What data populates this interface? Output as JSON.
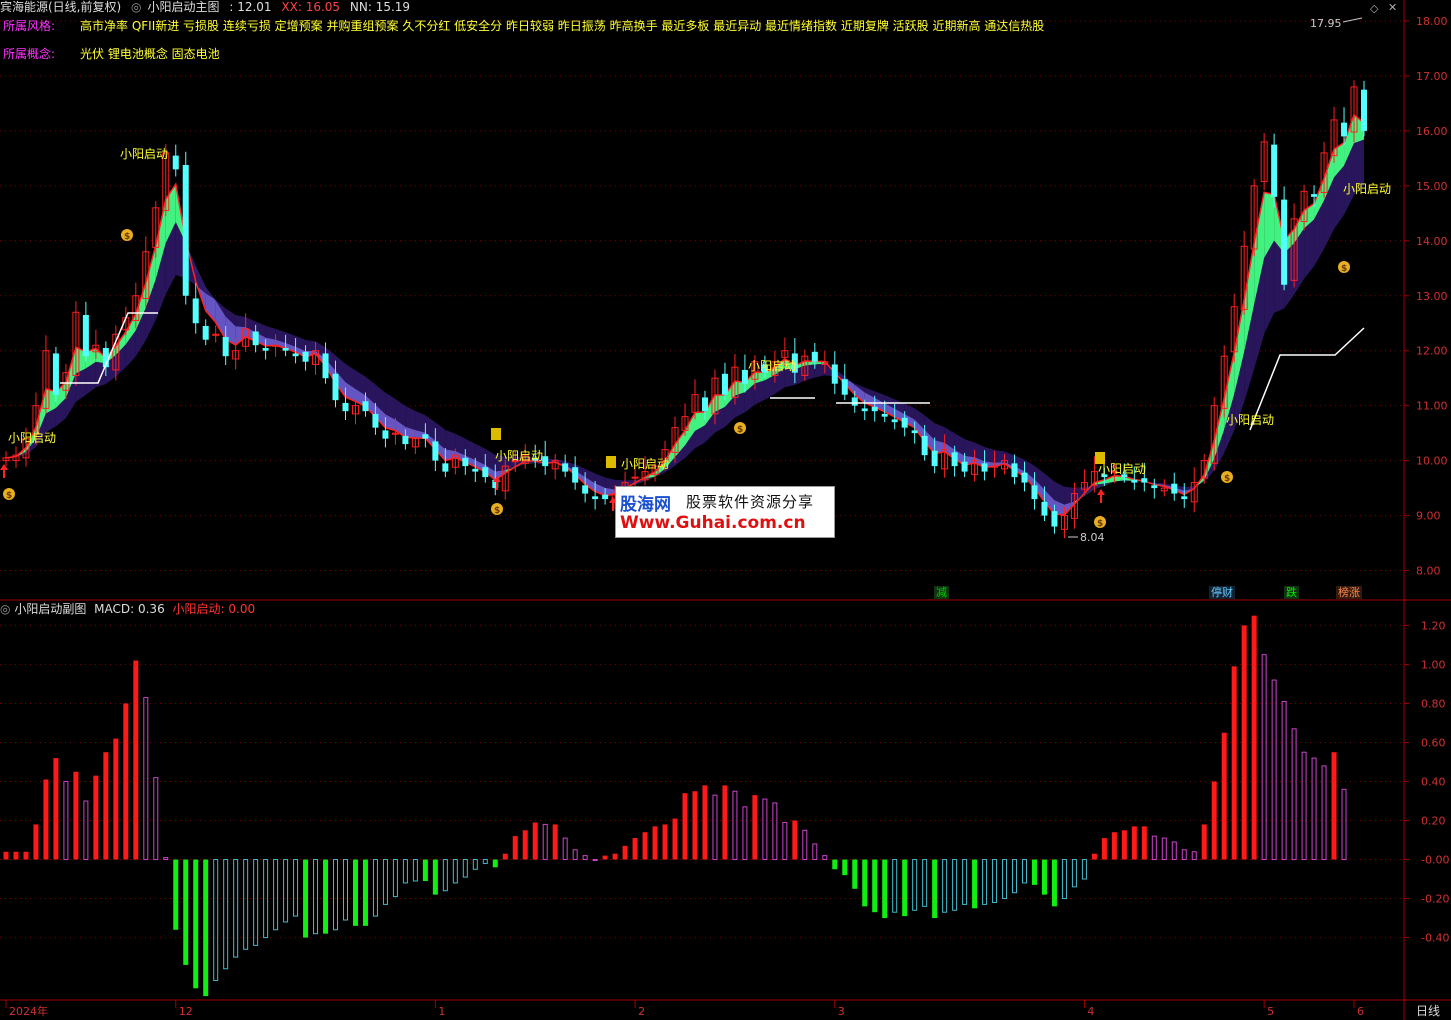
{
  "header": {
    "stock": "宾海能源(日线,前复权)",
    "indicator": "小阳启动主图",
    "v1_label": ": 12.01",
    "xx_label": "XX: 16.05",
    "nn_label": "NN: 15.19"
  },
  "style_row": {
    "label": "所属风格:",
    "value": "高市净率 QFII新进 亏损股 连续亏损 定增预案 并购重组预案 久不分红 低安全分 昨日较弱 昨日振荡 昨高换手 最近多板 最近异动 最近情绪指数 近期复牌 活跃股 近期新高 通达信热股"
  },
  "concept_row": {
    "label": "所属概念:",
    "value": "光伏 锂电池概念 固态电池"
  },
  "sub_header": {
    "title": "小阳启动副图",
    "macd_label": "MACD: 0.36",
    "signal_label": "小阳启动: 0.00"
  },
  "watermark": {
    "brand": "股海网",
    "slogan": "股票软件资源分享",
    "url": "Www.Guhai.com.cn"
  },
  "footer": {
    "period": "日线"
  },
  "signal_tags": [
    {
      "text": "减",
      "color": "#00cc00"
    },
    {
      "text": "停财",
      "color": "#66ccff"
    },
    {
      "text": "跌",
      "color": "#00ee00"
    },
    {
      "text": "榜涨",
      "color": "#ff8844"
    }
  ],
  "annotations": {
    "signal_text": "小阳启动",
    "high_label": "17.95",
    "low_label": "8.04"
  },
  "colors": {
    "up": "#ff2020",
    "down": "#54ffff",
    "ribbon_up": "#44ff88",
    "ribbon_down": "#6a5acd",
    "ribbon_dark": "#2a1660",
    "macd_up_strong": "#ff1a1a",
    "macd_up_weak": "#cc44cc",
    "macd_down_strong": "#11ee11",
    "macd_down_weak": "#44bbcc",
    "grid": "#7a0000",
    "axis_text": "#d03030",
    "yellow_text": "#ffff33",
    "magenta_text": "#ff33ff"
  },
  "chart_data": [
    {
      "type": "candlestick",
      "title": "",
      "ylim": [
        7.5,
        18.2
      ],
      "y_ticks": [
        "18.00",
        "17.00",
        "16.00",
        "15.00",
        "14.00",
        "13.00",
        "12.00",
        "11.00",
        "10.00",
        "9.00",
        "8.00"
      ],
      "x_ticks": [
        "2024年",
        "12",
        "1",
        "2",
        "3",
        "4",
        "5",
        "6"
      ],
      "close": [
        10.05,
        10.1,
        10.4,
        11.0,
        12.0,
        11.2,
        11.6,
        12.7,
        11.9,
        12.1,
        11.7,
        12.3,
        12.6,
        13.0,
        13.8,
        14.6,
        15.6,
        15.3,
        13.0,
        12.5,
        12.2,
        12.3,
        11.9,
        12.0,
        12.4,
        12.1,
        12.0,
        12.1,
        12.0,
        11.9,
        11.8,
        12.0,
        11.5,
        11.1,
        10.9,
        11.0,
        10.9,
        10.6,
        10.4,
        10.5,
        10.3,
        10.4,
        10.4,
        10.0,
        9.8,
        10.1,
        9.9,
        9.8,
        9.7,
        9.5,
        9.9,
        10.0,
        10.1,
        10.0,
        9.9,
        10.0,
        9.8,
        9.6,
        9.4,
        9.3,
        9.3,
        9.4,
        9.6,
        9.7,
        9.8,
        9.9,
        10.2,
        10.6,
        10.8,
        11.2,
        10.9,
        11.5,
        11.2,
        11.7,
        11.4,
        11.8,
        11.6,
        11.8,
        12.0,
        11.6,
        11.9,
        11.8,
        11.8,
        11.4,
        11.2,
        11.0,
        10.9,
        10.9,
        10.8,
        10.7,
        10.6,
        10.5,
        10.1,
        9.9,
        10.2,
        9.9,
        9.8,
        10.0,
        9.8,
        9.9,
        10.0,
        9.7,
        9.6,
        9.3,
        9.0,
        8.8,
        9.0,
        9.4,
        9.6,
        9.8,
        9.7,
        9.8,
        9.7,
        9.6,
        9.6,
        9.5,
        9.5,
        9.4,
        9.3,
        9.6,
        10.0,
        11.0,
        11.9,
        12.8,
        13.9,
        15.0,
        15.8,
        14.8,
        13.2,
        14.4,
        14.9,
        14.8,
        15.6,
        16.2,
        15.9,
        16.8,
        16.0
      ],
      "high_label": 17.95,
      "low_label": 8.04
    },
    {
      "type": "bar",
      "title": "",
      "ylim": [
        -0.72,
        1.32
      ],
      "y_ticks": [
        "1.20",
        "1.00",
        "0.80",
        "0.60",
        "0.40",
        "0.20",
        "-0.00",
        "-0.20",
        "-0.40"
      ],
      "series": [
        {
          "values": [
            0.04,
            0.04,
            0.04,
            0.18,
            0.41,
            0.52,
            0.4,
            0.45,
            0.3,
            0.43,
            0.55,
            0.62,
            0.8,
            1.02,
            0.83,
            0.42,
            0.01,
            -0.36,
            -0.54,
            -0.66,
            -0.7,
            -0.62,
            -0.56,
            -0.5,
            -0.46,
            -0.44,
            -0.4,
            -0.36,
            -0.32,
            -0.29,
            -0.4,
            -0.38,
            -0.38,
            -0.36,
            -0.31,
            -0.34,
            -0.34,
            -0.29,
            -0.23,
            -0.19,
            -0.12,
            -0.11,
            -0.11,
            -0.18,
            -0.16,
            -0.12,
            -0.09,
            -0.05,
            -0.02,
            -0.04,
            0.03,
            0.12,
            0.15,
            0.19,
            0.18,
            0.18,
            0.11,
            0.05,
            0.02,
            0.0,
            0.02,
            0.03,
            0.07,
            0.11,
            0.14,
            0.17,
            0.18,
            0.21,
            0.34,
            0.35,
            0.38,
            0.33,
            0.38,
            0.35,
            0.27,
            0.33,
            0.31,
            0.29,
            0.19,
            0.2,
            0.15,
            0.08,
            0.02,
            -0.05,
            -0.08,
            -0.15,
            -0.24,
            -0.27,
            -0.3,
            -0.27,
            -0.29,
            -0.26,
            -0.24,
            -0.3,
            -0.27,
            -0.26,
            -0.23,
            -0.25,
            -0.23,
            -0.22,
            -0.2,
            -0.17,
            -0.12,
            -0.13,
            -0.18,
            -0.24,
            -0.2,
            -0.14,
            -0.1,
            0.03,
            0.11,
            0.14,
            0.15,
            0.17,
            0.17,
            0.12,
            0.11,
            0.09,
            0.05,
            0.04,
            0.18,
            0.4,
            0.65,
            0.99,
            1.2,
            1.25,
            1.05,
            0.92,
            0.81,
            0.67,
            0.55,
            0.52,
            0.48,
            0.55,
            0.36
          ]
        }
      ]
    }
  ]
}
